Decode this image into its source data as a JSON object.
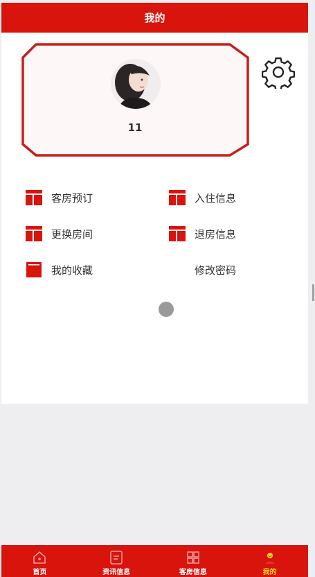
{
  "header": {
    "title": "我的"
  },
  "profile": {
    "username": "11",
    "avatar": "avatar-photo"
  },
  "settings": {
    "icon": "gear-icon"
  },
  "menu": {
    "items": [
      {
        "label": "客房预订",
        "icon": "room-icon"
      },
      {
        "label": "入住信息",
        "icon": "room-icon"
      },
      {
        "label": "更换房间",
        "icon": "room-icon"
      },
      {
        "label": "退房信息",
        "icon": "room-icon"
      },
      {
        "label": "我的收藏",
        "icon": "favorite-icon"
      },
      {
        "label": "修改密码",
        "icon": ""
      }
    ]
  },
  "tabbar": {
    "items": [
      {
        "label": "首页",
        "icon": "home-icon"
      },
      {
        "label": "资讯信息",
        "icon": "news-icon"
      },
      {
        "label": "客房信息",
        "icon": "grid-icon"
      },
      {
        "label": "我的",
        "icon": "user-icon",
        "active": true
      }
    ]
  },
  "colors": {
    "primary": "#d8140c",
    "active_tab": "#f8d51e",
    "text": "#333333",
    "background": "#eeeef0"
  }
}
